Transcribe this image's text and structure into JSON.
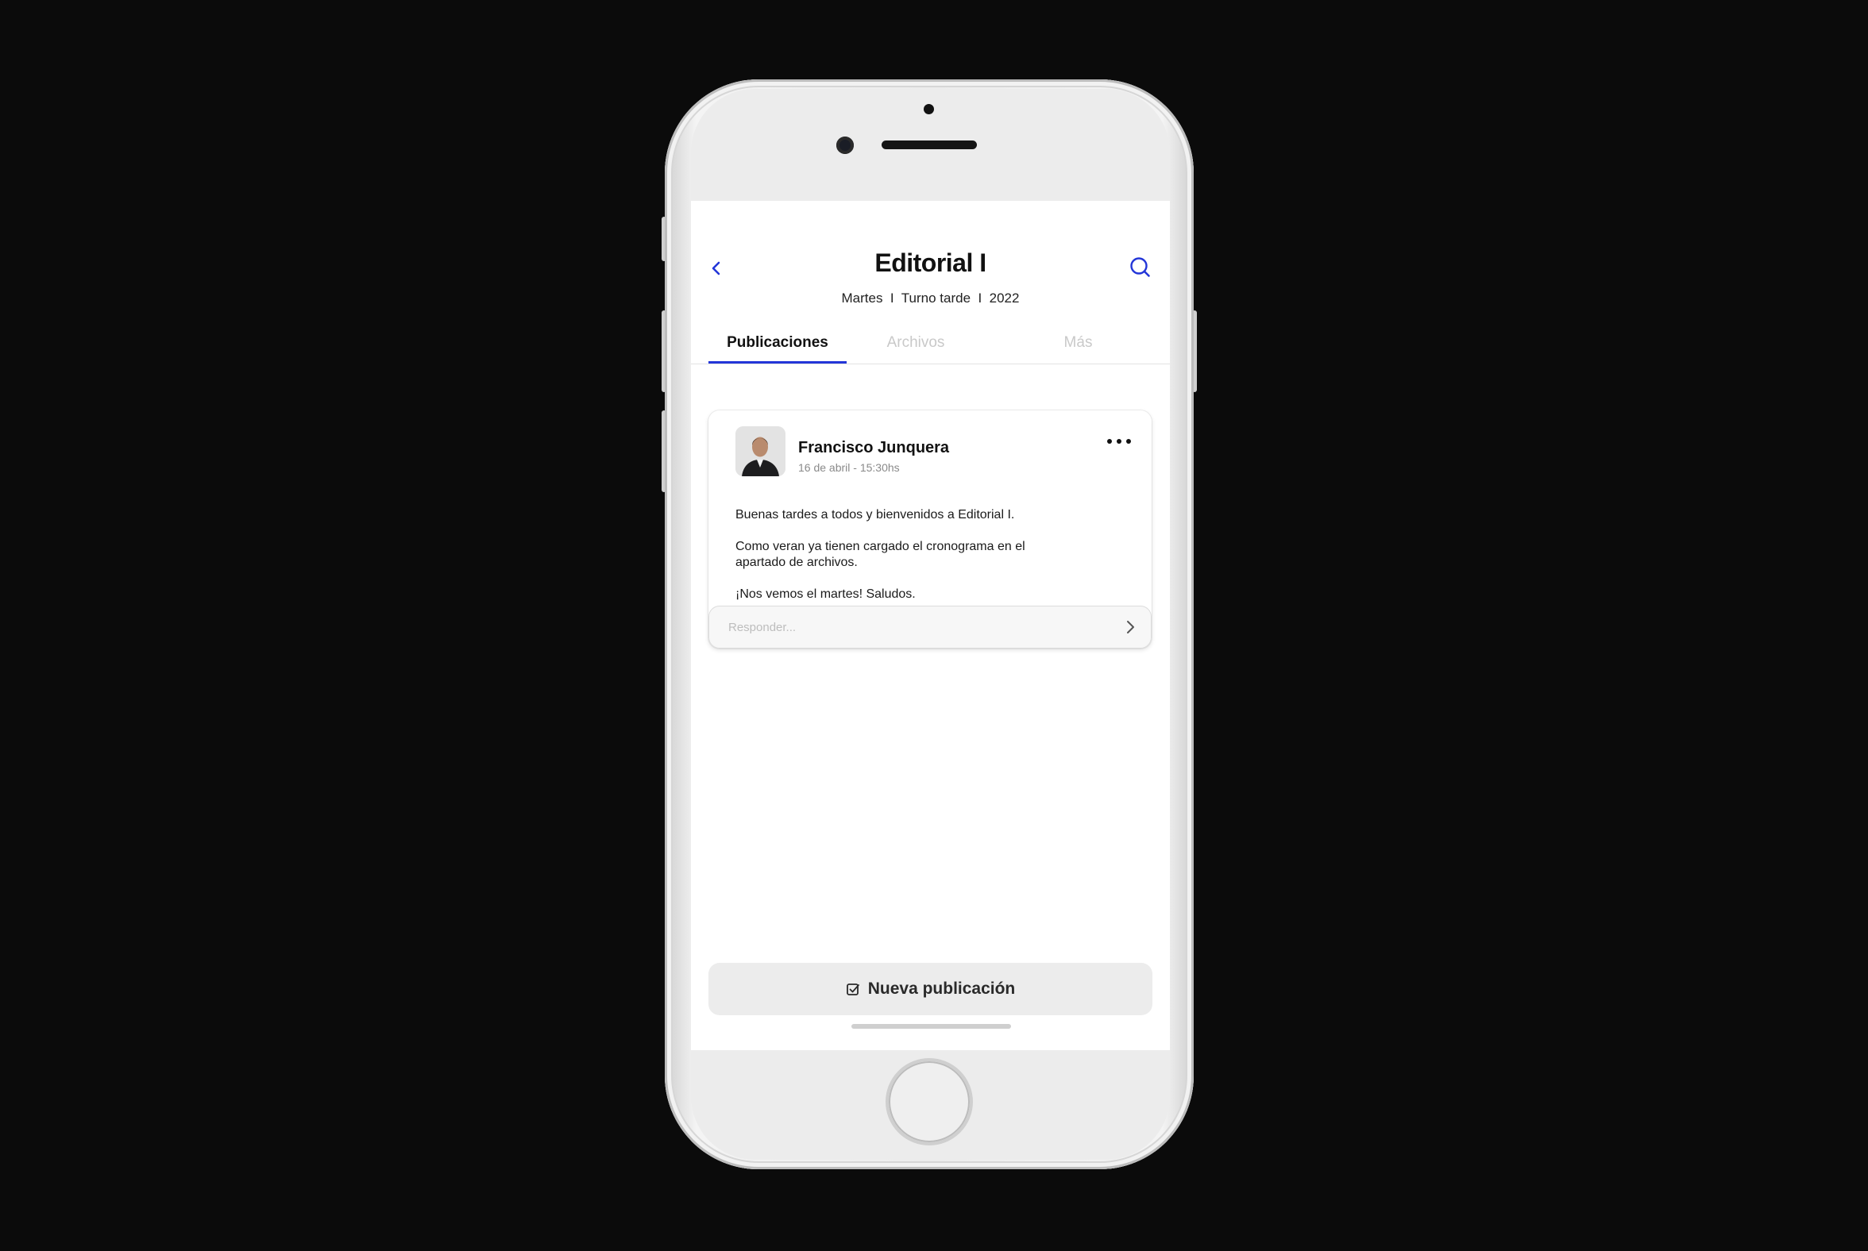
{
  "header": {
    "title": "Editorial I",
    "subtitle": "Martes  I  Turno tarde  I  2022"
  },
  "tabs": [
    {
      "label": "Publicaciones",
      "active": true
    },
    {
      "label": "Archivos",
      "active": false
    },
    {
      "label": "Más",
      "active": false
    }
  ],
  "post": {
    "author": "Francisco Junquera",
    "date": "16 de abril - 15:30hs",
    "body": [
      "Buenas tardes a todos y bienvenidos a Editorial I.",
      "Como veran ya tienen cargado el cronograma en el apartado de archivos.",
      "¡Nos vemos el martes! Saludos."
    ],
    "reply_placeholder": "Responder..."
  },
  "actions": {
    "new_post_label": "Nueva publicación"
  },
  "colors": {
    "accent": "#2336d8",
    "background": "#0b0b0b"
  },
  "icons": {
    "back": "chevron-left-icon",
    "search": "search-icon",
    "more": "more-horizontal-icon",
    "send": "chevron-right-icon",
    "new_post": "checkbox-icon"
  }
}
